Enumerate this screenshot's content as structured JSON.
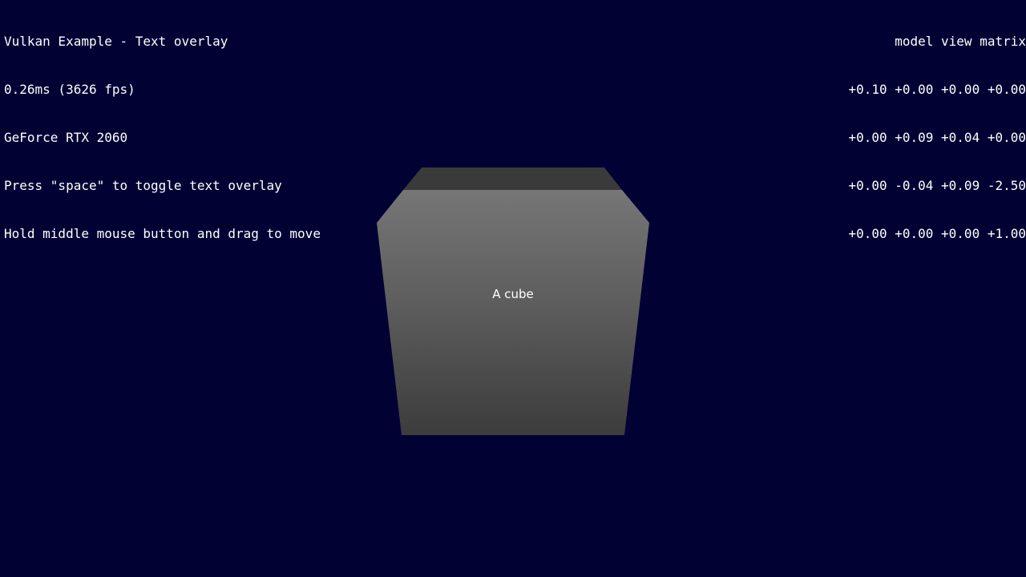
{
  "overlay": {
    "title": "Vulkan Example - Text overlay",
    "frame_time": "0.26ms (3626 fps)",
    "gpu": "GeForce RTX 2060",
    "hint_space": "Press \"space\" to toggle text overlay",
    "hint_mouse": "Hold middle mouse button and drag to move"
  },
  "matrix": {
    "label": "model view matrix",
    "rows": [
      "+0.10 +0.00 +0.00 +0.00",
      "+0.00 +0.09 +0.04 +0.00",
      "+0.00 -0.04 +0.09 -2.50",
      "+0.00 +0.00 +0.00 +1.00"
    ]
  },
  "scene": {
    "cube_label": "A cube",
    "background_color": "#010133",
    "cube_top_color": "#3a3a3a",
    "cube_front_top_color": "#737373",
    "cube_front_bottom_color": "#3e3e3e"
  }
}
